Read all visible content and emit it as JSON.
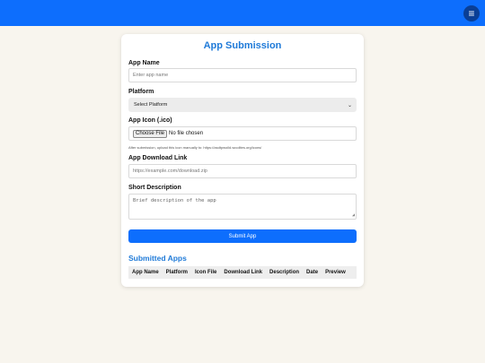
{
  "header": {
    "menu_icon": "hamburger-menu-icon",
    "menu_glyph": "≡"
  },
  "form": {
    "title": "App Submission",
    "app_name": {
      "label": "App Name",
      "placeholder": "Enter app name"
    },
    "platform": {
      "label": "Platform",
      "selected": "Select Platform"
    },
    "icon": {
      "label": "App Icon (.ico)",
      "button": "Choose File",
      "status": "No file chosen",
      "hint": "After submission, upload this icon manually to: https://asdtpwoild.woolites.org/icons/"
    },
    "download": {
      "label": "App Download Link",
      "placeholder": "https://example.com/download.zip"
    },
    "description": {
      "label": "Short Description",
      "placeholder": "Brief description of the app"
    },
    "submit_label": "Submit App"
  },
  "submitted": {
    "title": "Submitted Apps",
    "columns": [
      "App Name",
      "Platform",
      "Icon File",
      "Download Link",
      "Description",
      "Date",
      "Preview"
    ]
  },
  "colors": {
    "primary": "#0d6efd",
    "title": "#1f7ad8",
    "background": "#f8f5ee"
  }
}
